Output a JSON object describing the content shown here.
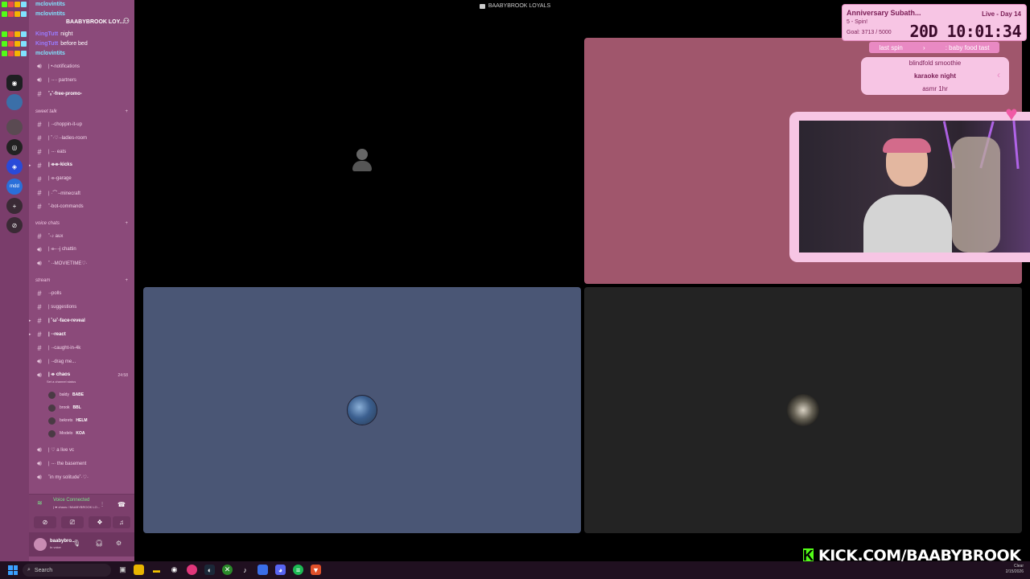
{
  "window": {
    "title": "BAABYBROOK LOYALS"
  },
  "chat_overlay": [
    {
      "name": "mclovintits",
      "msg": "",
      "color": "#7fe3ff"
    },
    {
      "name": "mclovintits",
      "msg": "",
      "color": "#7fe3ff"
    },
    {
      "name": "KingTutt",
      "msg": "night",
      "color": "#9a7bff"
    },
    {
      "name": "KingTutt",
      "msg": "before bed",
      "color": "#9a7bff"
    },
    {
      "name": "mclovintits",
      "msg": "",
      "color": "#7fe3ff"
    }
  ],
  "server": {
    "name": "BAABYBROOK LOY..."
  },
  "channels_top": [
    {
      "icon": "speaker",
      "label": "| •-notifications"
    },
    {
      "icon": "speaker",
      "label": "| ·-·· partners"
    },
    {
      "icon": "hash",
      "label": "˚ₓ˚-free-promo-",
      "bold": true
    }
  ],
  "category_sweet": "sweet talk",
  "channels_sweet": [
    {
      "icon": "hash",
      "label": "|  ·-choppin-it-up"
    },
    {
      "icon": "hash",
      "label": "| ˚·♡·-ladies-room"
    },
    {
      "icon": "hash",
      "label": "| ·-· eats"
    },
    {
      "icon": "hash",
      "label": "| ⌯⌯-kicks",
      "bold": true,
      "arrow": true
    },
    {
      "icon": "hash",
      "label": "| ⌯-garage"
    },
    {
      "icon": "hash",
      "label": "| ·⌒·-minecraft"
    },
    {
      "icon": "hash",
      "label": "˚-bot-commands"
    }
  ],
  "category_voice": "voice chats",
  "channels_voice": [
    {
      "icon": "hash",
      "label": "˚-♪ aux"
    },
    {
      "icon": "speaker",
      "label": "| ⌯-·-j chattin"
    },
    {
      "icon": "speaker",
      "label": "˚ ·-MOVIETIME♡·"
    }
  ],
  "category_stream": "stream",
  "channels_stream": [
    {
      "icon": "hash",
      "label": "·-polls"
    },
    {
      "icon": "hash",
      "label": "|  suggestions"
    },
    {
      "icon": "hash",
      "label": "| ˚ω˚-face-reveal",
      "bold": true,
      "arrow": true
    },
    {
      "icon": "hash",
      "label": "| ·-react",
      "bold": true,
      "arrow": true
    },
    {
      "icon": "hash",
      "label": "| ·-caught-in-4k"
    },
    {
      "icon": "speaker",
      "label": "| ·-drag me..."
    }
  ],
  "voice_channel": {
    "label": "| ⌯ chaos",
    "time": "24:58",
    "status": "Set a channel status"
  },
  "voice_users": [
    {
      "name": "baldy",
      "tag": "BABE"
    },
    {
      "name": "brook",
      "tag": "BBL"
    },
    {
      "name": "bekrets",
      "tag": "HELM"
    },
    {
      "name": "Modelo",
      "tag": "KOA"
    }
  ],
  "channels_bottom": [
    {
      "icon": "speaker",
      "label": "| ♡ a live vc"
    },
    {
      "icon": "speaker",
      "label": "| ·-· the basement"
    },
    {
      "icon": "speaker",
      "label": "˚in my solitude˚·♡·"
    }
  ],
  "voice_panel": {
    "status": "Voice Connected",
    "sub": "| ⌯ chaos / BAABYBROOK LO..."
  },
  "user_panel": {
    "name": "baabybro...",
    "sub": "In voice"
  },
  "subathon": {
    "title": "Anniversary Subath...",
    "live": "Live - Day 14",
    "spin": "5 - Spin!",
    "goal": "Goal: 3713 / 5000",
    "timer": "20D 10:01:34"
  },
  "wheel": {
    "last_spin_label": "last spin",
    "last_spin_value": ": baby food tast",
    "items": [
      "blindfold smoothie",
      "karaoke night",
      "asmr 1hr"
    ]
  },
  "kick": {
    "badge": "K",
    "text": "KICK.COM/BAABYBROOK"
  },
  "taskbar": {
    "search_placeholder": "Search",
    "tray_line1": "Clear",
    "tray_date": "2/15/2026"
  },
  "colors": {
    "accent_pink": "#f7c5e4",
    "sidebar": "#8b4a7a",
    "kick_green": "#53fc18"
  }
}
